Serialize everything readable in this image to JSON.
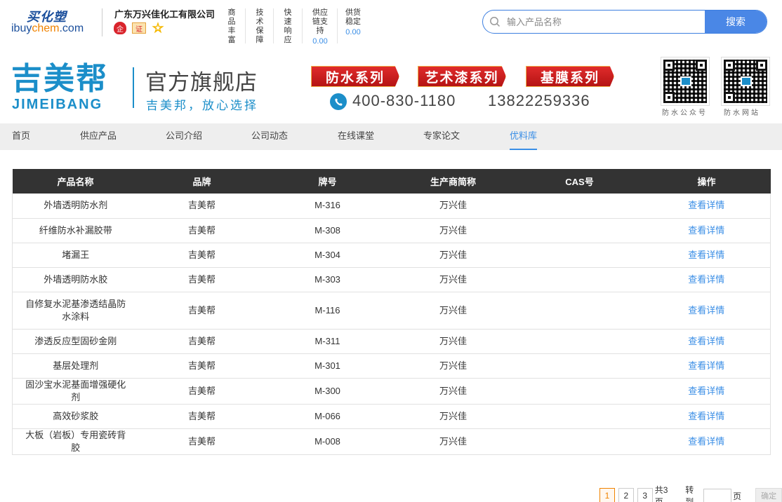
{
  "header": {
    "logo_top": "买化塑",
    "logo_bottom_a": "ibuy",
    "logo_bottom_b": "chem",
    "logo_bottom_c": ".com",
    "company": "广东万兴佳化工有限公司",
    "badges": [
      "企",
      "证",
      "★"
    ],
    "features": [
      {
        "label": "商品丰富",
        "value": ""
      },
      {
        "label": "技术保障",
        "value": ""
      },
      {
        "label": "快速响应",
        "value": ""
      },
      {
        "label": "供应链支持",
        "value": "0.00"
      },
      {
        "label": "供货稳定",
        "value": "0.00"
      }
    ],
    "search": {
      "placeholder": "输入产品名称",
      "button": "搜索"
    }
  },
  "banner": {
    "brand_cn": "吉美帮",
    "brand_en": "JIMEIBANG",
    "store": "官方旗舰店",
    "slogan": "吉美邦，放心选择",
    "series": [
      "防水系列",
      "艺术漆系列",
      "基膜系列"
    ],
    "phone1": "400-830-1180",
    "phone2": "13822259336",
    "qr_labels": [
      "防水公众号",
      "防水网站"
    ]
  },
  "nav": [
    "首页",
    "供应产品",
    "公司介绍",
    "公司动态",
    "在线课堂",
    "专家论文",
    "优料库"
  ],
  "table": {
    "headers": [
      "产品名称",
      "品牌",
      "牌号",
      "生产商简称",
      "CAS号",
      "操作"
    ],
    "action_label": "查看详情",
    "rows": [
      [
        "外墙透明防水剂",
        "吉美帮",
        "M-316",
        "万兴佳",
        ""
      ],
      [
        "纤维防水补漏胶带",
        "吉美帮",
        "M-308",
        "万兴佳",
        ""
      ],
      [
        "堵漏王",
        "吉美帮",
        "M-304",
        "万兴佳",
        ""
      ],
      [
        "外墙透明防水胶",
        "吉美帮",
        "M-303",
        "万兴佳",
        ""
      ],
      [
        "自修复水泥基渗透结晶防水涂料",
        "吉美帮",
        "M-116",
        "万兴佳",
        ""
      ],
      [
        "渗透反应型固砂金刚",
        "吉美帮",
        "M-311",
        "万兴佳",
        ""
      ],
      [
        "基层处理剂",
        "吉美帮",
        "M-301",
        "万兴佳",
        ""
      ],
      [
        "固沙宝水泥基面增强硬化剂",
        "吉美帮",
        "M-300",
        "万兴佳",
        ""
      ],
      [
        "高效砂浆胶",
        "吉美帮",
        "M-066",
        "万兴佳",
        ""
      ],
      [
        "大板（岩板）专用瓷砖背胶",
        "吉美帮",
        "M-008",
        "万兴佳",
        ""
      ]
    ]
  },
  "pager": {
    "pages": [
      "1",
      "2",
      "3"
    ],
    "total": "共3页",
    "goto": "转到",
    "unit": "页",
    "go_button": "确定"
  }
}
